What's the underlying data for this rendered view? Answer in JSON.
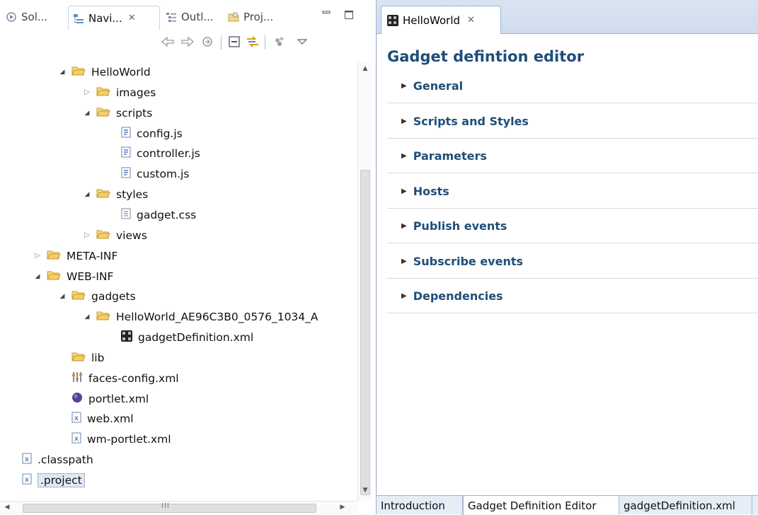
{
  "navigator": {
    "tabs": [
      {
        "label": "Sol...",
        "icon": "solution-icon"
      },
      {
        "label": "Navi...",
        "icon": "navigator-icon",
        "close": "✕"
      },
      {
        "label": "Outl...",
        "icon": "outline-icon"
      },
      {
        "label": "Proj...",
        "icon": "project-icon"
      }
    ],
    "minimize": "▭",
    "maximize": "□",
    "toolbar": [
      "back-arrow-icon",
      "forward-arrow-icon",
      "home-icon",
      "collapse-all-icon",
      "link-with-editor-icon",
      "filters-icon",
      "view-menu-icon"
    ],
    "tree": [
      {
        "label": "HelloWorld",
        "depth": 3,
        "arrow": "open",
        "icon": "folder"
      },
      {
        "label": "images",
        "depth": 4,
        "arrow": "closed",
        "icon": "folder"
      },
      {
        "label": "scripts",
        "depth": 4,
        "arrow": "open",
        "icon": "folder"
      },
      {
        "label": "config.js",
        "depth": 5,
        "arrow": "none",
        "icon": "js"
      },
      {
        "label": "controller.js",
        "depth": 5,
        "arrow": "none",
        "icon": "js"
      },
      {
        "label": "custom.js",
        "depth": 5,
        "arrow": "none",
        "icon": "js"
      },
      {
        "label": "styles",
        "depth": 4,
        "arrow": "open",
        "icon": "folder"
      },
      {
        "label": "gadget.css",
        "depth": 5,
        "arrow": "none",
        "icon": "css"
      },
      {
        "label": "views",
        "depth": 4,
        "arrow": "closed",
        "icon": "folder"
      },
      {
        "label": "META-INF",
        "depth": 2,
        "arrow": "closed",
        "icon": "folder"
      },
      {
        "label": "WEB-INF",
        "depth": 2,
        "arrow": "open",
        "icon": "folder"
      },
      {
        "label": "gadgets",
        "depth": 3,
        "arrow": "open",
        "icon": "folder"
      },
      {
        "label": "HelloWorld_AE96C3B0_0576_1034_A",
        "depth": 4,
        "arrow": "open",
        "icon": "folder"
      },
      {
        "label": "gadgetDefinition.xml",
        "depth": 5,
        "arrow": "none",
        "icon": "gadget"
      },
      {
        "label": "lib",
        "depth": 3,
        "arrow": "none",
        "icon": "folder"
      },
      {
        "label": "faces-config.xml",
        "depth": 3,
        "arrow": "none",
        "icon": "faces"
      },
      {
        "label": "portlet.xml",
        "depth": 3,
        "arrow": "none",
        "icon": "portlet"
      },
      {
        "label": "web.xml",
        "depth": 3,
        "arrow": "none",
        "icon": "xml"
      },
      {
        "label": "wm-portlet.xml",
        "depth": 3,
        "arrow": "none",
        "icon": "xml"
      },
      {
        "label": ".classpath",
        "depth": 1,
        "arrow": "none",
        "icon": "xml"
      },
      {
        "label": ".project",
        "depth": 1,
        "arrow": "none",
        "icon": "xml",
        "selected": true
      }
    ],
    "hscroll_grip": "III"
  },
  "editor": {
    "tab_label": "HelloWorld",
    "tab_close": "✕",
    "title": "Gadget defintion editor",
    "sections": [
      "General",
      "Scripts and Styles",
      "Parameters",
      "Hosts",
      "Publish events",
      "Subscribe events",
      "Dependencies"
    ],
    "bottom_tabs": [
      {
        "label": "Introduction",
        "active": false
      },
      {
        "label": "Gadget Definition Editor",
        "active": true
      },
      {
        "label": "gadgetDefinition.xml",
        "active": false
      }
    ]
  },
  "colors": {
    "folder": "#e8b84a",
    "heading": "#1f4e79",
    "tabbar": "#d4e0ef"
  }
}
